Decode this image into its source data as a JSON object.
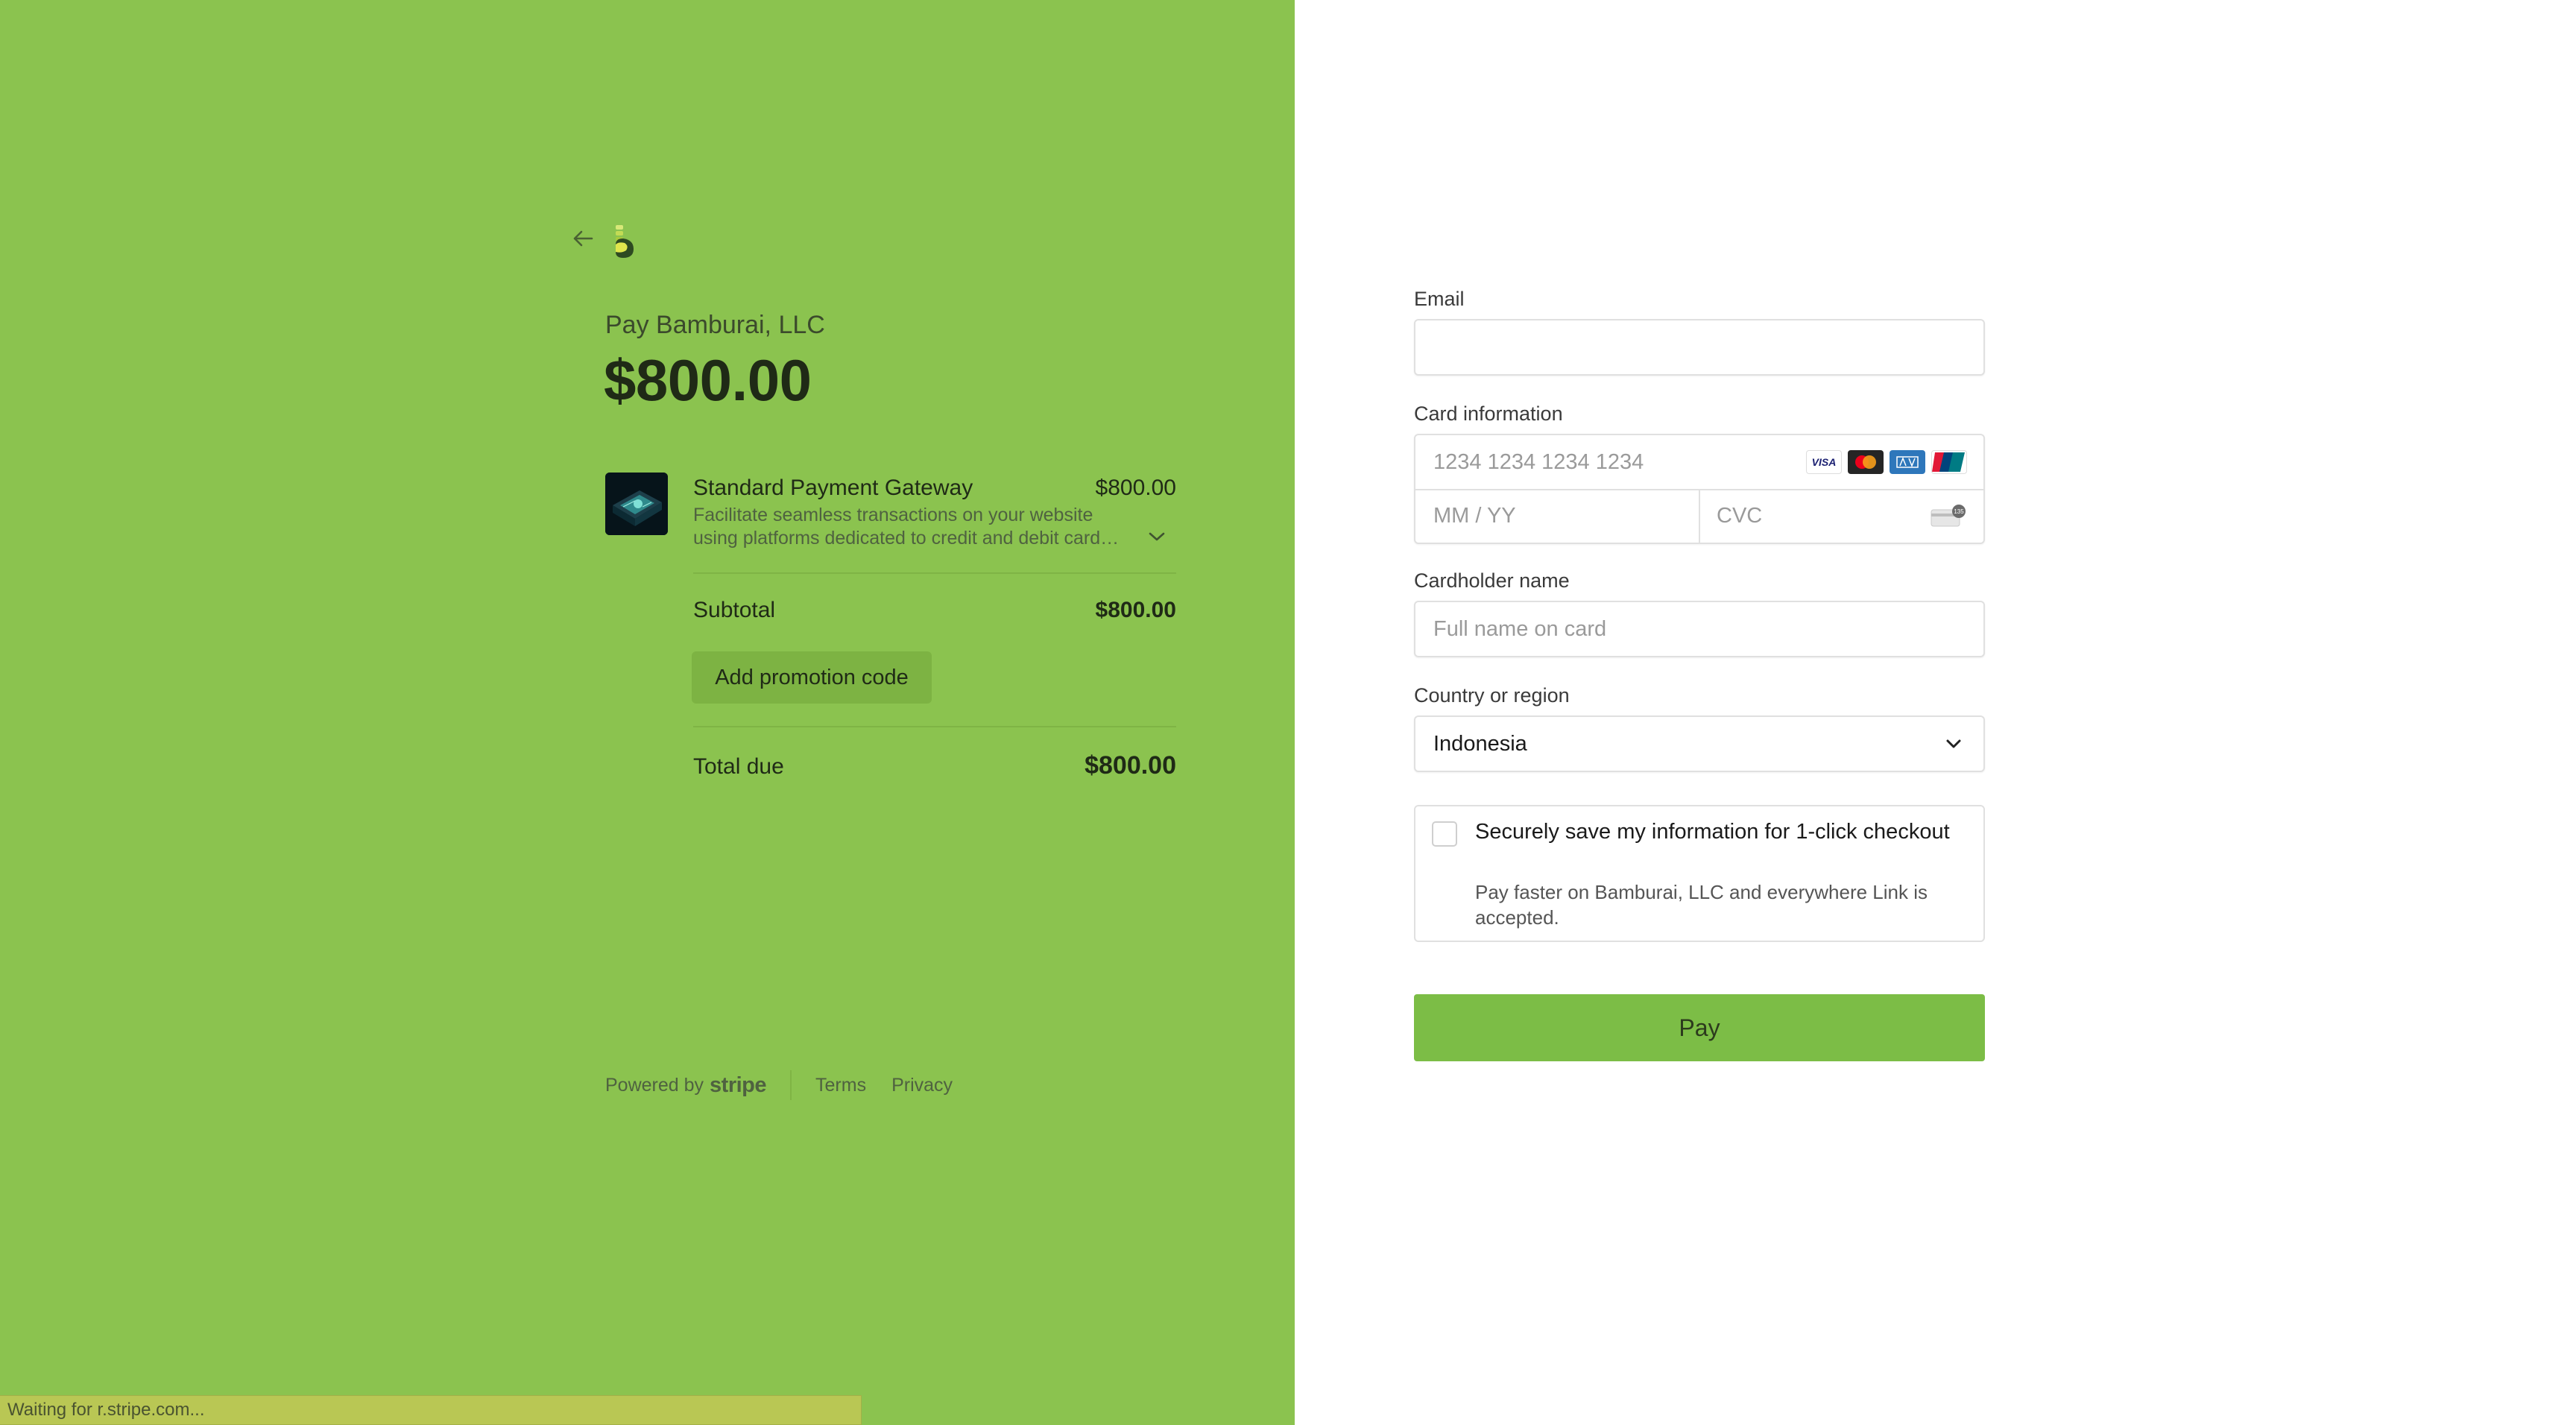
{
  "summary": {
    "merchant_line": "Pay Bamburai, LLC",
    "amount": "$800.00",
    "product": {
      "name": "Standard Payment Gateway",
      "price": "$800.00",
      "description": "Facilitate seamless transactions on your website using platforms dedicated to credit and debit card payments."
    },
    "subtotal_label": "Subtotal",
    "subtotal_value": "$800.00",
    "promo_label": "Add promotion code",
    "total_label": "Total due",
    "total_value": "$800.00"
  },
  "footer": {
    "powered_by": "Powered by",
    "brand": "stripe",
    "terms": "Terms",
    "privacy": "Privacy"
  },
  "status_bar": "Waiting for r.stripe.com...",
  "form": {
    "email_label": "Email",
    "email_value": "",
    "card_label": "Card information",
    "card_number_placeholder": "1234 1234 1234 1234",
    "expiry_placeholder": "MM / YY",
    "cvc_placeholder": "CVC",
    "card_brands": [
      "VISA",
      "mastercard",
      "amex",
      "unionpay"
    ],
    "cardholder_label": "Cardholder name",
    "cardholder_placeholder": "Full name on card",
    "country_label": "Country or region",
    "country_value": "Indonesia",
    "save_title": "Securely save my information for 1-click checkout",
    "save_sub": "Pay faster on Bamburai, LLC and everywhere Link is accepted.",
    "pay_label": "Pay"
  },
  "colors": {
    "brand_green": "#8bc34f",
    "pay_button": "#7cbd46"
  }
}
